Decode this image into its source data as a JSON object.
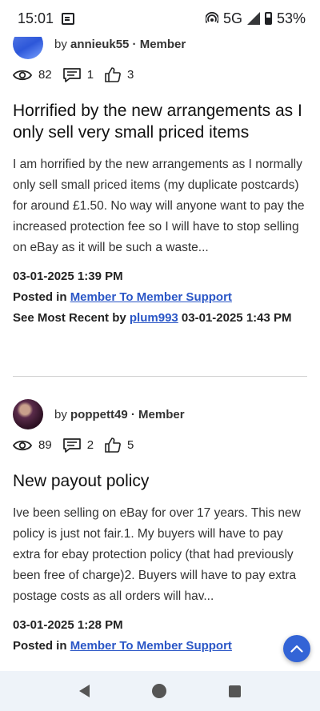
{
  "status_bar": {
    "time": "15:01",
    "network": "5G",
    "battery": "53%"
  },
  "posts": [
    {
      "author_prefix": "by ",
      "author": "annieuk55",
      "role": " · Member",
      "views": "82",
      "replies": "1",
      "likes": "3",
      "title": "Horrified by the new arrangements as I only sell very small priced items",
      "excerpt": "I am horrified by the new arrangements as I normally only sell small priced items (my duplicate postcards) for around £1.50. No way will anyone want to pay the increased protection fee so I will have to stop selling on eBay as it will be such a waste...",
      "date": "03-01-2025 1:39 PM",
      "posted_in_label": "Posted in ",
      "board": "Member To Member Support",
      "recent_label": "See Most Recent by ",
      "recent_user": "plum993",
      "recent_date": " 03-01-2025 1:43 PM"
    },
    {
      "author_prefix": "by ",
      "author": "poppett49",
      "role": " · Member",
      "views": "89",
      "replies": "2",
      "likes": "5",
      "title": "New payout policy",
      "excerpt": "Ive been selling on eBay for over 17 years. This new policy is just not fair.1. My buyers will have to pay extra for ebay protection policy (that had previously been free of charge)2. Buyers will have to pay extra postage costs as all orders will hav...",
      "date": "03-01-2025 1:28 PM",
      "posted_in_label": "Posted in ",
      "board": "Member To Member Support"
    }
  ]
}
